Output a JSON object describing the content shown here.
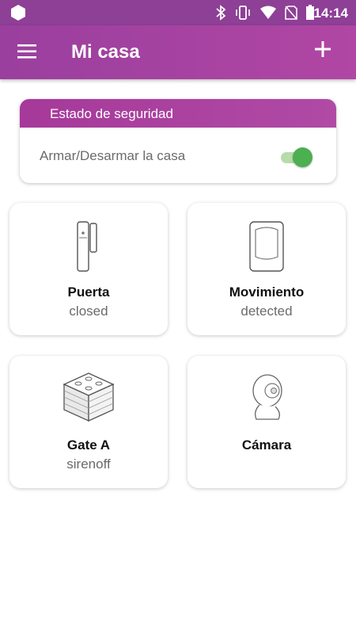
{
  "statusbar": {
    "time": "14:14",
    "icons": [
      "app-hex-icon",
      "bluetooth-icon",
      "vibrate-icon",
      "wifi-icon",
      "no-sim-icon",
      "battery-icon"
    ]
  },
  "appbar": {
    "title": "Mi casa",
    "menu_icon": "hamburger-menu-icon",
    "add_icon": "plus-icon"
  },
  "security": {
    "header": "Estado de seguridad",
    "toggle_label": "Armar/Desarmar la casa",
    "toggle_on": true
  },
  "devices": [
    {
      "name": "Puerta",
      "status": "closed",
      "icon": "door-sensor-icon"
    },
    {
      "name": "Movimiento",
      "status": "detected",
      "icon": "motion-sensor-icon"
    },
    {
      "name": "Gate A",
      "status": "sirenoff",
      "icon": "gateway-hub-icon"
    },
    {
      "name": "Cámara",
      "status": "",
      "icon": "camera-icon"
    }
  ],
  "colors": {
    "primary": "#9a3f9e",
    "statusbar": "#8e3f96",
    "toggle_on": "#4caf50"
  }
}
